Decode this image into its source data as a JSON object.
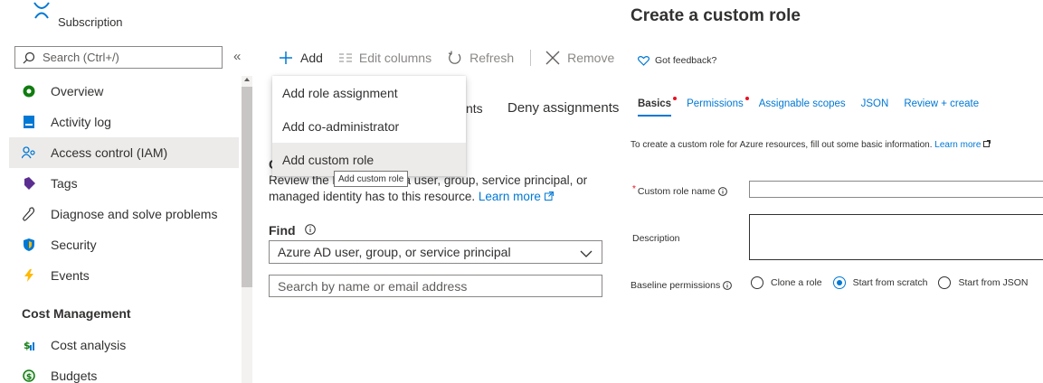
{
  "left": {
    "subscription_label": "Subscription",
    "search_placeholder": "Search (Ctrl+/)",
    "collapse_glyph": "«",
    "nav": [
      {
        "label": "Overview",
        "icon": "overview-icon"
      },
      {
        "label": "Activity log",
        "icon": "activity-log-icon"
      },
      {
        "label": "Access control (IAM)",
        "icon": "iam-icon",
        "selected": true
      },
      {
        "label": "Tags",
        "icon": "tag-icon"
      },
      {
        "label": "Diagnose and solve problems",
        "icon": "wrench-icon"
      },
      {
        "label": "Security",
        "icon": "shield-icon"
      },
      {
        "label": "Events",
        "icon": "lightning-icon"
      }
    ],
    "section_header": "Cost Management",
    "cost_nav": [
      {
        "label": "Cost analysis",
        "icon": "cost-analysis-icon"
      },
      {
        "label": "Budgets",
        "icon": "budgets-icon"
      }
    ]
  },
  "middle": {
    "toolbar": {
      "add": "Add",
      "edit_columns": "Edit columns",
      "refresh": "Refresh",
      "remove": "Remove"
    },
    "dropdown": {
      "items": [
        "Add role assignment",
        "Add co-administrator",
        "Add custom role"
      ]
    },
    "tooltip": "Add custom role",
    "tab_fragment": "nts",
    "tab_deny": "Deny assignments",
    "heading_fragment": "C",
    "review_part1": "Review the l",
    "review_part2": "a user, group, service principal, or",
    "review_line2": "managed identity has to this resource.",
    "learn_more": "Learn more",
    "find_label": "Find",
    "find_select_value": "Azure AD user, group, or service principal",
    "search_placeholder": "Search by name or email address"
  },
  "right": {
    "title": "Create a custom role",
    "feedback": "Got feedback?",
    "tabs": [
      {
        "label": "Basics",
        "active": true,
        "required": true
      },
      {
        "label": "Permissions",
        "required": true
      },
      {
        "label": "Assignable scopes"
      },
      {
        "label": "JSON"
      },
      {
        "label": "Review + create"
      }
    ],
    "intro": "To create a custom role for Azure resources, fill out some basic information.",
    "intro_link": "Learn more",
    "role_name_label": "Custom role name",
    "description_label": "Description",
    "baseline_label": "Baseline permissions",
    "radio_options": [
      {
        "label": "Clone a role",
        "checked": false
      },
      {
        "label": "Start from scratch",
        "checked": true
      },
      {
        "label": "Start from JSON",
        "checked": false
      }
    ]
  },
  "colors": {
    "accent": "#0078d4",
    "required": "#e81123",
    "selected_bg": "#edebe9"
  }
}
